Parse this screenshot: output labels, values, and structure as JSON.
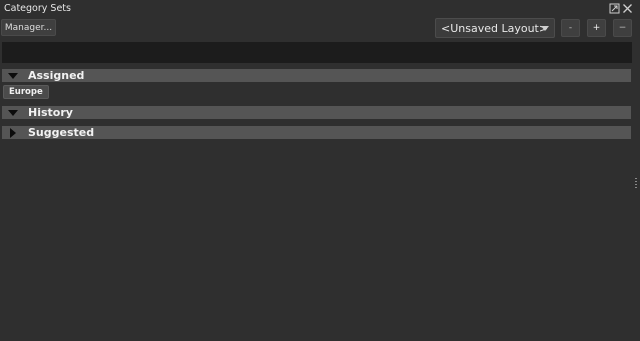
{
  "window": {
    "title": "Category Sets"
  },
  "toolbar": {
    "manager_label": "Manager...",
    "layout_value": "<Unsaved Layout>",
    "minus_label": "-",
    "plus_label": "+",
    "remove_label": "−"
  },
  "search": {
    "value": "",
    "placeholder": ""
  },
  "sections": {
    "assigned": {
      "label": "Assigned",
      "expanded": true
    },
    "history": {
      "label": "History",
      "expanded": true
    },
    "suggested": {
      "label": "Suggested",
      "expanded": false
    }
  },
  "assigned_tags": [
    {
      "label": "Europe"
    }
  ],
  "icons": {
    "popout": "popout-icon",
    "close": "close-icon",
    "expanded": "triangle-down-icon",
    "collapsed": "triangle-right-icon",
    "dropdown": "chevron-down-icon",
    "grip": "resize-grip-icon"
  },
  "colors": {
    "panel_bg": "#2f2f2f",
    "section_header_bg": "#555555",
    "search_bg": "#1c1c1c"
  }
}
